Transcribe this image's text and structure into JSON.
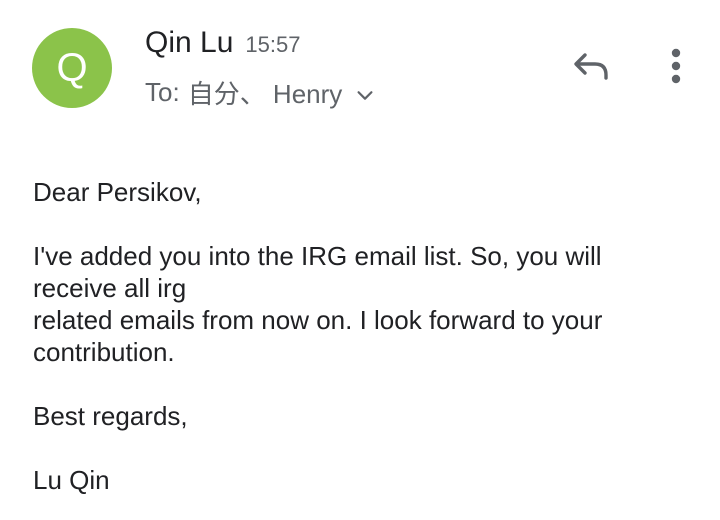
{
  "colors": {
    "avatar_bg": "#8bc34a",
    "text_primary": "#202124",
    "text_secondary": "#5f6368",
    "icon": "#5f6368"
  },
  "header": {
    "avatar_letter": "Q",
    "sender_name": "Qin Lu",
    "time": "15:57",
    "to_label": "To:",
    "recipients": "自分、 Henry",
    "icons": {
      "expand": "chevron-down-icon",
      "reply": "reply-icon",
      "more": "more-vert-icon"
    }
  },
  "message": {
    "greeting": "Dear Persikov,",
    "line1": "I've added you into the IRG email list. So, you will",
    "line2": "receive all irg",
    "line3": "related emails from now on.  I look forward to your",
    "line4": "contribution.",
    "closing": "Best regards,",
    "signature": "Lu Qin"
  }
}
